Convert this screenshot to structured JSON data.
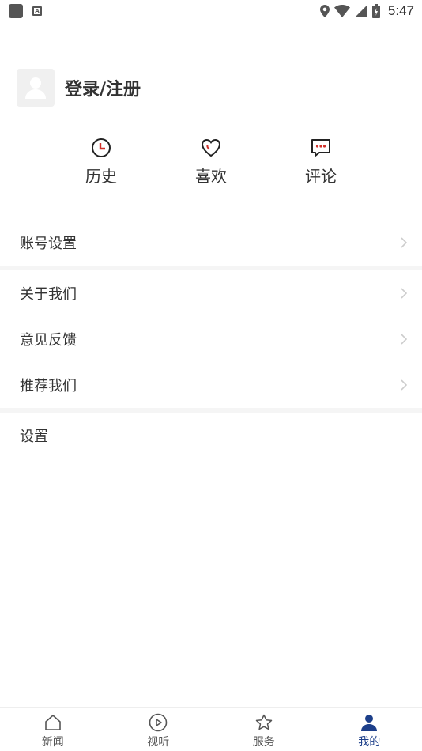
{
  "status_bar": {
    "time": "5:47"
  },
  "profile": {
    "login_label": "登录/注册"
  },
  "quick_actions": [
    {
      "label": "历史",
      "icon": "clock-icon"
    },
    {
      "label": "喜欢",
      "icon": "heart-icon"
    },
    {
      "label": "评论",
      "icon": "comment-icon"
    }
  ],
  "menu": {
    "group1": [
      {
        "label": "账号设置"
      }
    ],
    "group2": [
      {
        "label": "关于我们"
      },
      {
        "label": "意见反馈"
      },
      {
        "label": "推荐我们"
      }
    ],
    "group3": [
      {
        "label": "设置"
      }
    ]
  },
  "bottom_nav": [
    {
      "label": "新闻",
      "icon": "home-icon"
    },
    {
      "label": "视听",
      "icon": "play-icon"
    },
    {
      "label": "服务",
      "icon": "star-icon"
    },
    {
      "label": "我的",
      "icon": "person-icon",
      "active": true
    }
  ],
  "colors": {
    "accent": "#1d3f8a",
    "icon_red": "#d0302a"
  }
}
